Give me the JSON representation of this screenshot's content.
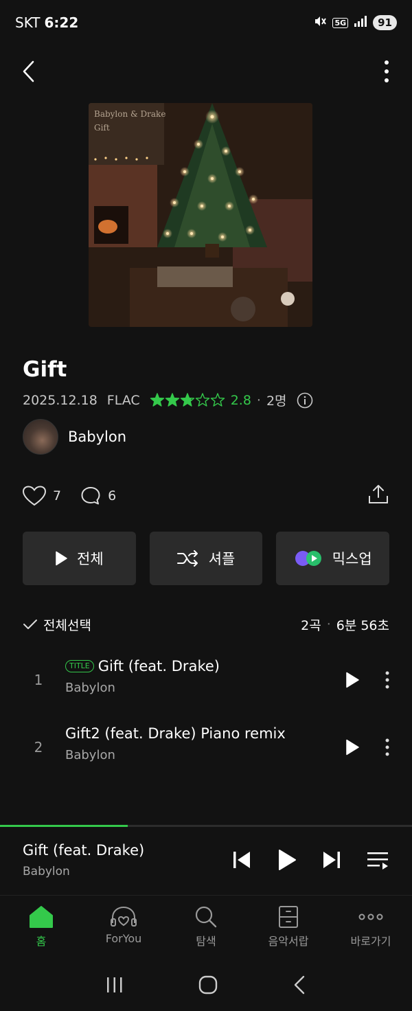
{
  "status_bar": {
    "carrier": "SKT",
    "time": "6:22",
    "network": "5G",
    "battery": "91"
  },
  "album": {
    "art_artist_text": "Babylon & Drake",
    "art_title_text": "Gift",
    "title": "Gift",
    "release_date": "2025.12.18",
    "format": "FLAC",
    "rating": "2.8",
    "rating_value": 2.8,
    "rating_count": "2명",
    "artist": "Babylon",
    "likes": "7",
    "comments": "6"
  },
  "actions": {
    "play_all": "전체",
    "shuffle": "셔플",
    "mixup": "믹스업"
  },
  "tracklist": {
    "select_all": "전체선택",
    "count": "2곡",
    "duration": "6분 56초",
    "tracks": [
      {
        "num": "1",
        "badge": "TITLE",
        "title": "Gift (feat. Drake)",
        "artist": "Babylon"
      },
      {
        "num": "2",
        "badge": "",
        "title": "Gift2 (feat. Drake) Piano remix",
        "artist": "Babylon"
      }
    ]
  },
  "player": {
    "title": "Gift (feat. Drake)",
    "artist": "Babylon",
    "progress": 0.31
  },
  "bottom_nav": {
    "items": [
      {
        "label": "홈",
        "icon": "home-icon",
        "active": true
      },
      {
        "label": "ForYou",
        "icon": "headphones-heart-icon",
        "active": false
      },
      {
        "label": "탐색",
        "icon": "search-icon",
        "active": false
      },
      {
        "label": "음악서랍",
        "icon": "drawer-icon",
        "active": false
      },
      {
        "label": "바로가기",
        "icon": "more-dots-icon",
        "active": false
      }
    ]
  },
  "colors": {
    "accent": "#34c94b",
    "background": "#121212",
    "button_bg": "#2b2b2b"
  }
}
